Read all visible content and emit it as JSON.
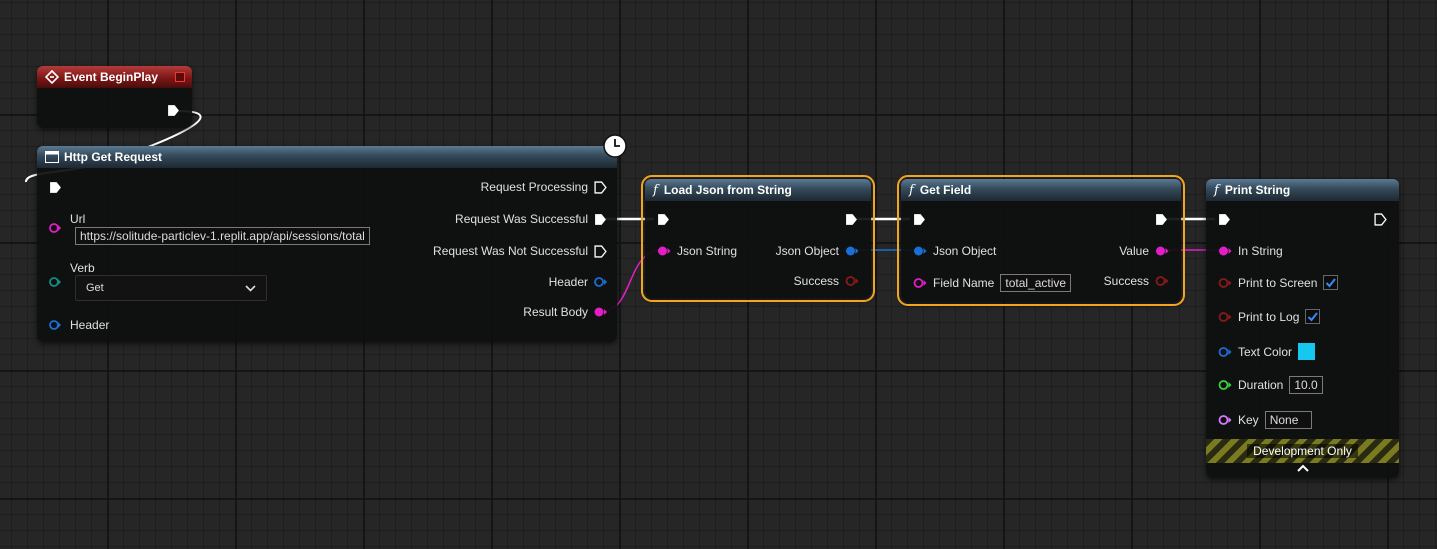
{
  "colors": {
    "exec": "#ffffff",
    "string_pin": "#e21ec7",
    "object_pin": "#1a6ed6",
    "bool_pin": "#8a1a1a",
    "name_pin": "#d77aff",
    "float_pin": "#3bd23b",
    "verb_pin": "#138e85",
    "text_color_value": "#16c7ef",
    "selection": "#f2a51f"
  },
  "nodes": {
    "begin_play": {
      "title": "Event BeginPlay",
      "icon": "diamond-event-icon"
    },
    "http": {
      "title": "Http Get Request",
      "icon": "window-icon",
      "url_label": "Url",
      "url_value": "https://solitude-particlev-1.replit.app/api/sessions/total",
      "verb_label": "Verb",
      "verb_value": "Get",
      "header_in_label": "Header",
      "out_processing": "Request Processing",
      "out_success": "Request Was Successful",
      "out_fail": "Request Was Not Successful",
      "out_header": "Header",
      "out_body": "Result Body",
      "latent_icon": "clock-icon"
    },
    "load_json": {
      "title": "Load Json from String",
      "in_string": "Json String",
      "out_object": "Json Object",
      "out_success": "Success"
    },
    "get_field": {
      "title": "Get Field",
      "in_object": "Json Object",
      "field_name_label": "Field Name",
      "field_name_value": "total_active",
      "out_value": "Value",
      "out_success": "Success"
    },
    "print_string": {
      "title": "Print String",
      "in_string": "In String",
      "print_screen": "Print to Screen",
      "print_screen_checked": true,
      "print_log": "Print to Log",
      "print_log_checked": true,
      "text_color": "Text Color",
      "duration": "Duration",
      "duration_value": "10.0",
      "key": "Key",
      "key_value": "None",
      "dev_only": "Development Only"
    }
  }
}
